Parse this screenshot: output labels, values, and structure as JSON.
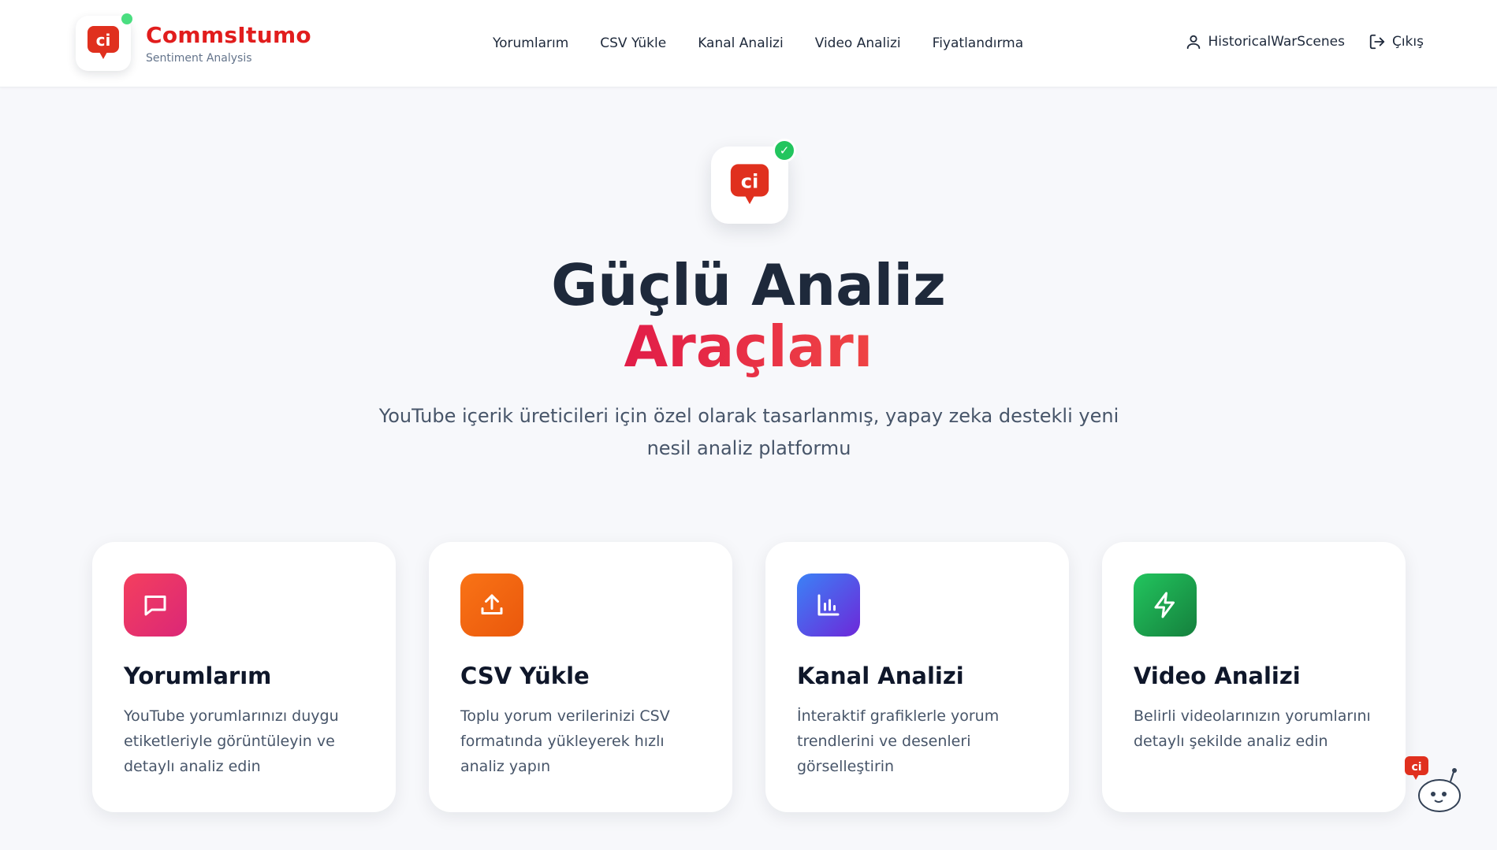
{
  "brand": {
    "name": "CommsItumo",
    "subtitle": "Sentiment Analysis",
    "logo_text": "ci"
  },
  "nav": {
    "items": [
      {
        "label": "Yorumlarım"
      },
      {
        "label": "CSV Yükle"
      },
      {
        "label": "Kanal Analizi"
      },
      {
        "label": "Video Analizi"
      },
      {
        "label": "Fiyatlandırma"
      }
    ]
  },
  "user": {
    "name": "HistoricalWarScenes",
    "logout_label": "Çıkış",
    "user_icon": "user-icon",
    "logout_icon": "logout-icon"
  },
  "hero": {
    "logo_text": "ci",
    "check": "✓",
    "title_line1": "Güçlü Analiz",
    "title_line2": "Araçları",
    "description": "YouTube içerik üreticileri için özel olarak tasarlanmış, yapay zeka destekli yeni nesil analiz platformu"
  },
  "cards": [
    {
      "title": "Yorumlarım",
      "description": "YouTube yorumlarınızı duygu etiketleriyle görüntüleyin ve detaylı analiz edin",
      "icon": "message-icon",
      "color": "#e11d48"
    },
    {
      "title": "CSV Yükle",
      "description": "Toplu yorum verilerinizi CSV formatında yükleyerek hızlı analiz yapın",
      "icon": "upload-icon",
      "color": "#f97316"
    },
    {
      "title": "Kanal Analizi",
      "description": "İnteraktif grafiklerle yorum trendlerini ve desenleri görselleştirin",
      "icon": "bar-chart-icon",
      "color": "#4f46e5"
    },
    {
      "title": "Video Analizi",
      "description": "Belirli videolarınızın yorumlarını detaylı şekilde analiz edin",
      "icon": "lightning-icon",
      "color": "#16a34a"
    }
  ],
  "mascot": {
    "logo_text": "ci"
  },
  "colors": {
    "brand_red": "#e11d1d",
    "online_dot": "#4ade80",
    "check_green": "#22c55e"
  }
}
